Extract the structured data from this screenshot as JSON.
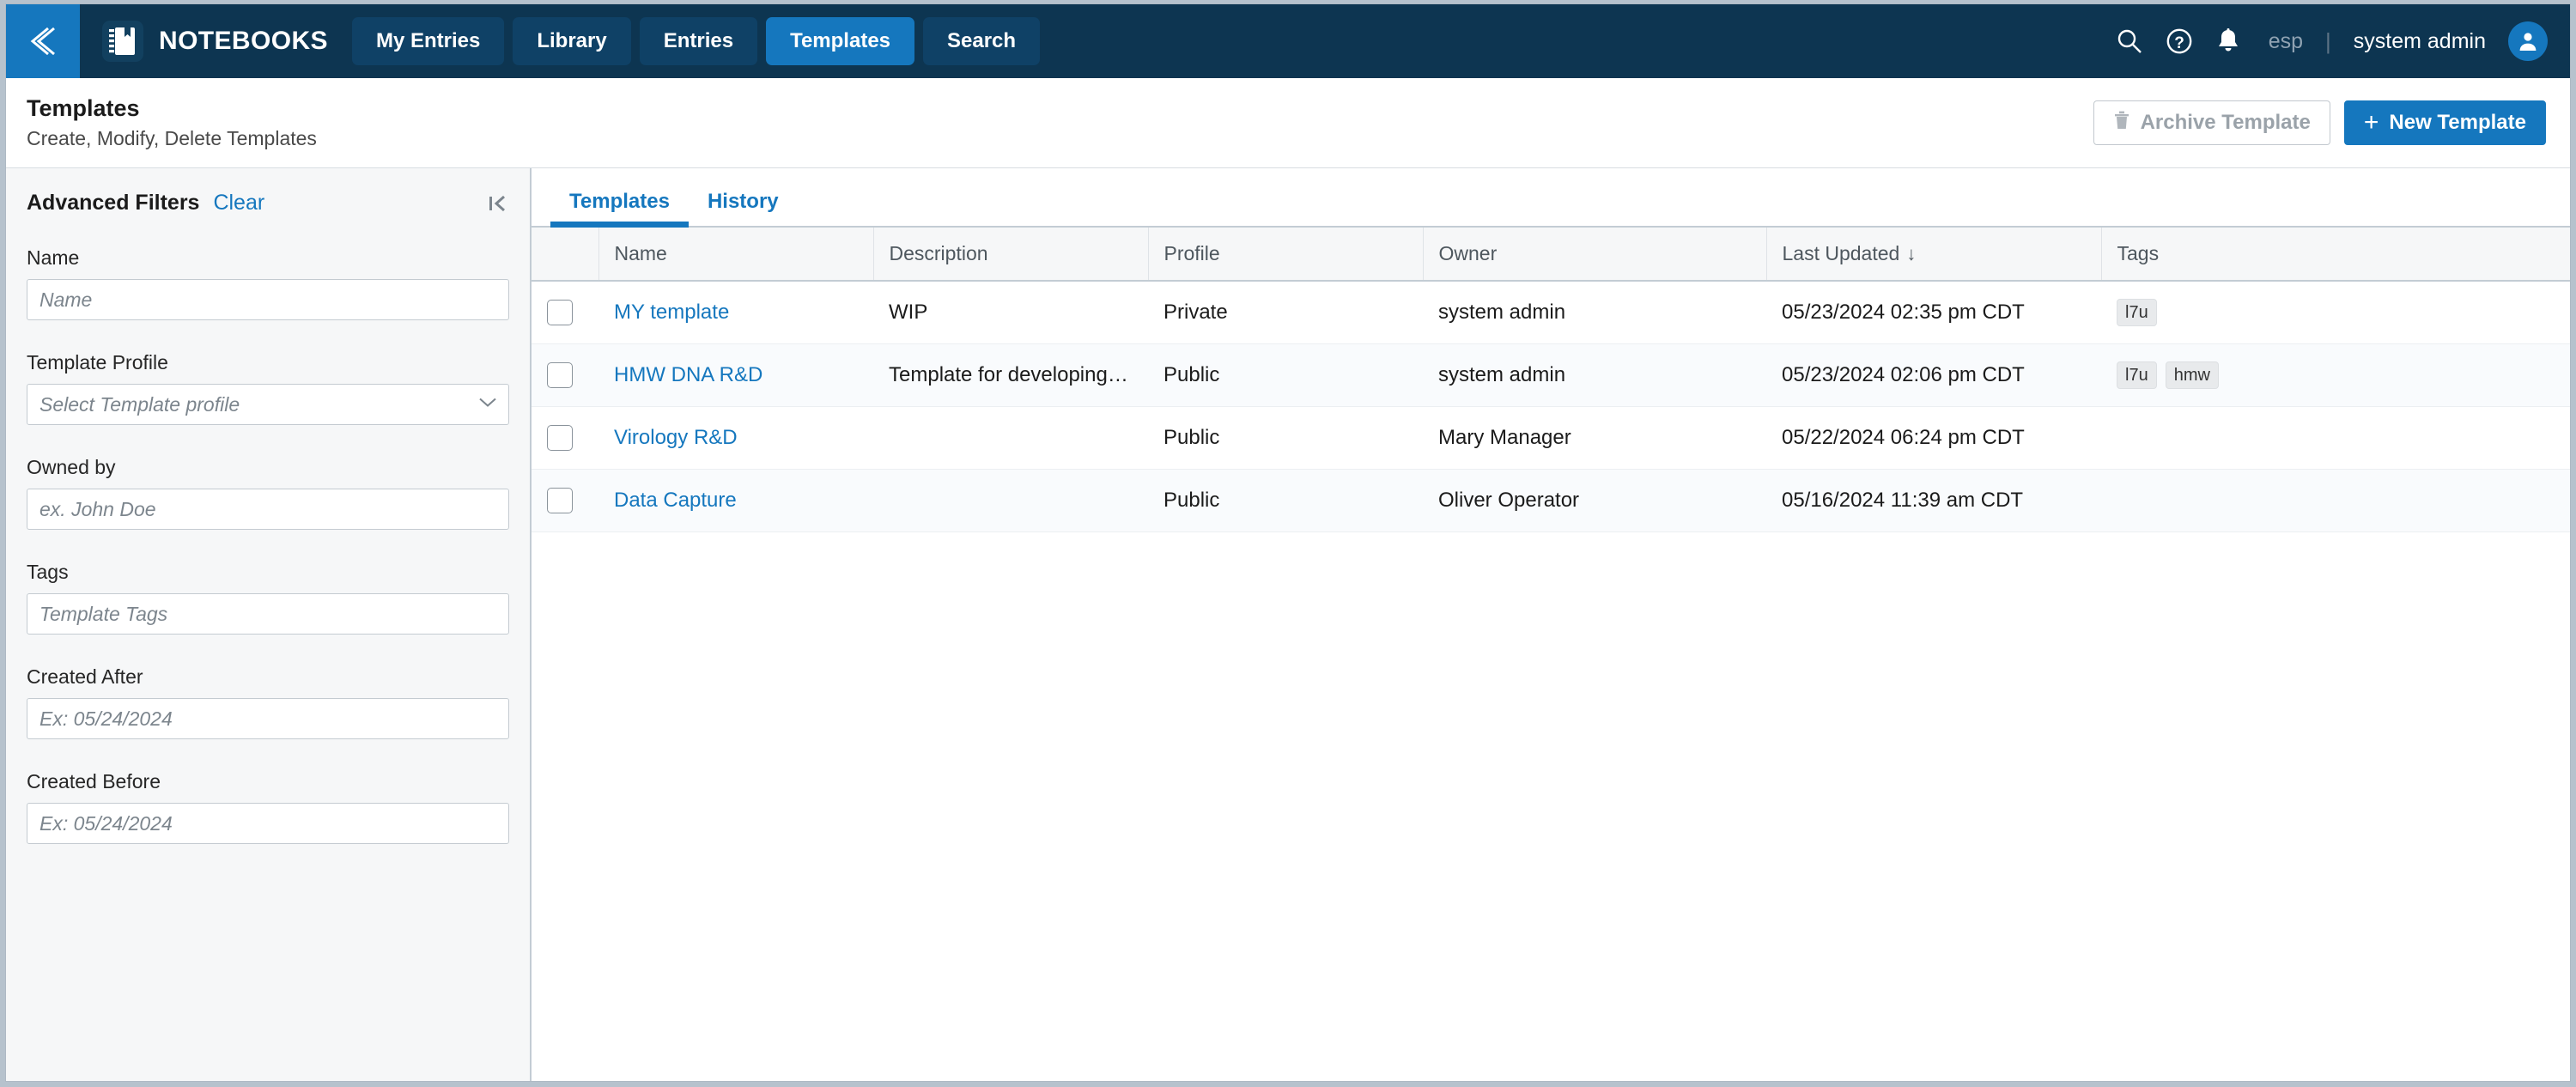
{
  "navbar": {
    "back_icon": "chevron-left-icon",
    "brand_icon": "notebook-icon",
    "brand": "NOTEBOOKS",
    "tabs": [
      {
        "label": "My Entries",
        "active": false
      },
      {
        "label": "Library",
        "active": false
      },
      {
        "label": "Entries",
        "active": false
      },
      {
        "label": "Templates",
        "active": true
      },
      {
        "label": "Search",
        "active": false
      }
    ],
    "icons": [
      "search-icon",
      "help-icon",
      "notification-bell-icon"
    ],
    "language": "esp",
    "separator": "|",
    "user": "system admin",
    "avatar_icon": "user-avatar-icon",
    "accent": "#1577be",
    "background": "#0d3551"
  },
  "page_header": {
    "title": "Templates",
    "subtitle": "Create, Modify, Delete Templates",
    "archive_button": "Archive Template",
    "archive_icon": "trash-icon",
    "new_button": "New Template",
    "new_icon": "plus-icon"
  },
  "sidebar": {
    "title": "Advanced Filters",
    "clear": "Clear",
    "collapse_icon": "collapse-left-icon",
    "fields": [
      {
        "label": "Name",
        "placeholder": "Name",
        "value": "",
        "type": "text"
      },
      {
        "label": "Template Profile",
        "placeholder": "Select Template profile",
        "value": "",
        "type": "select"
      },
      {
        "label": "Owned by",
        "placeholder": "ex. John Doe",
        "value": "",
        "type": "text"
      },
      {
        "label": "Tags",
        "placeholder": "Template Tags",
        "value": "",
        "type": "text"
      },
      {
        "label": "Created After",
        "placeholder": "Ex: 05/24/2024",
        "value": "",
        "type": "text"
      },
      {
        "label": "Created Before",
        "placeholder": "Ex: 05/24/2024",
        "value": "",
        "type": "text"
      }
    ]
  },
  "main": {
    "tabs": [
      {
        "label": "Templates",
        "active": true
      },
      {
        "label": "History",
        "active": false
      }
    ],
    "table": {
      "columns": [
        "",
        "Name",
        "Description",
        "Profile",
        "Owner",
        "Last Updated",
        "Tags"
      ],
      "sort_column": "Last Updated",
      "sort_arrow": "↓",
      "rows": [
        {
          "selected": false,
          "name": "MY template",
          "description": "WIP",
          "profile": "Private",
          "owner": "system admin",
          "last_updated": "05/23/2024 02:35 pm CDT",
          "tags": [
            "l7u"
          ]
        },
        {
          "selected": false,
          "name": "HMW DNA R&D",
          "description": "Template for developing …",
          "profile": "Public",
          "owner": "system admin",
          "last_updated": "05/23/2024 02:06 pm CDT",
          "tags": [
            "l7u",
            "hmw"
          ]
        },
        {
          "selected": false,
          "name": "Virology R&D",
          "description": "",
          "profile": "Public",
          "owner": "Mary Manager",
          "last_updated": "05/22/2024 06:24 pm CDT",
          "tags": []
        },
        {
          "selected": false,
          "name": "Data Capture",
          "description": "",
          "profile": "Public",
          "owner": "Oliver Operator",
          "last_updated": "05/16/2024 11:39 am CDT",
          "tags": []
        }
      ]
    }
  }
}
